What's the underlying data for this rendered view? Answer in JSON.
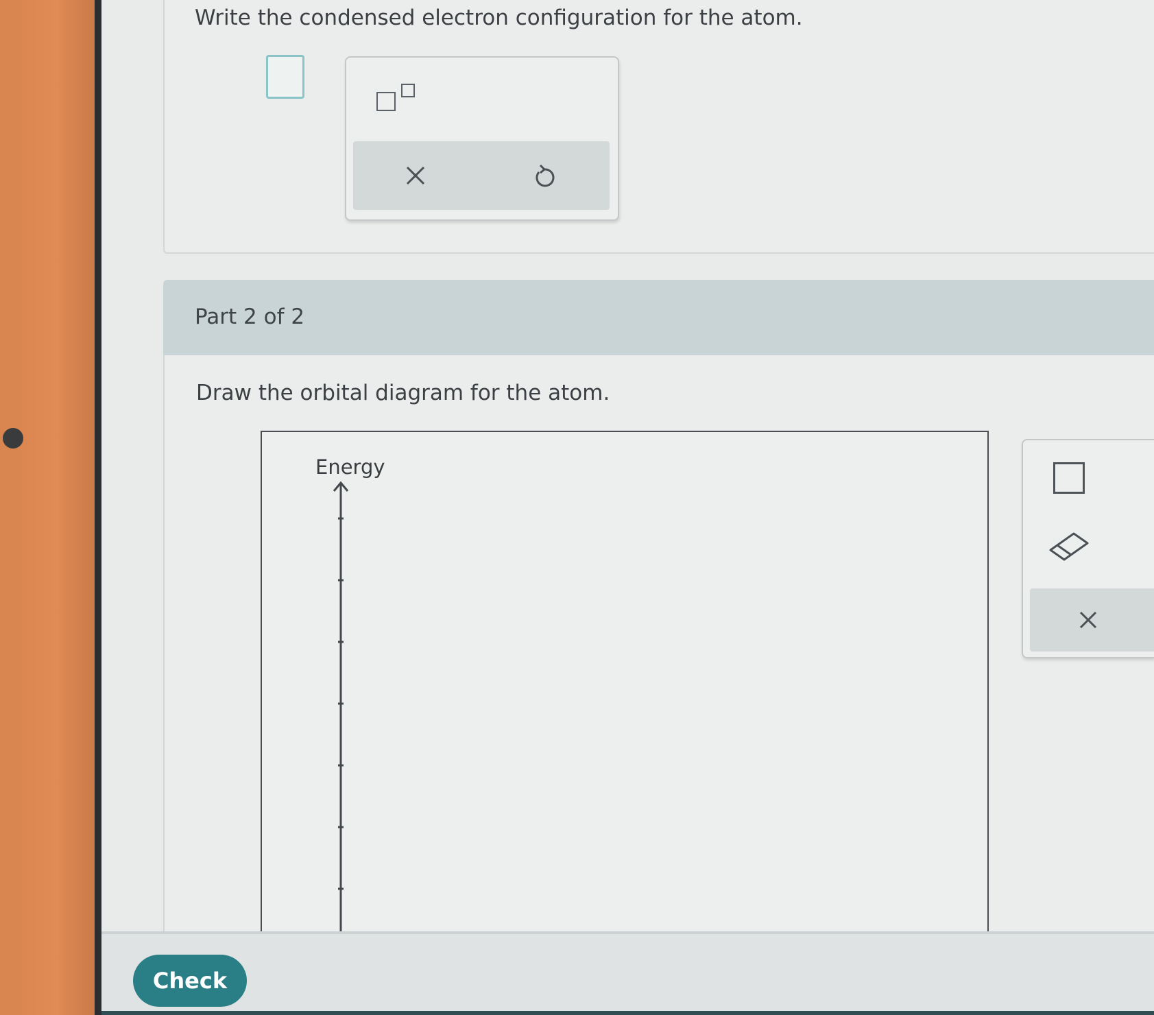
{
  "part1": {
    "prompt": "Write the condensed electron configuration for the atom.",
    "tools": {
      "superscript": "superscript-template-icon",
      "clear": "close-icon",
      "undo": "undo-icon"
    }
  },
  "part2": {
    "header": "Part 2 of 2",
    "prompt": "Draw the orbital diagram for the atom.",
    "diagram": {
      "axis_label": "Energy"
    },
    "tools": {
      "orbital_box": "orbital-box-icon",
      "eraser": "eraser-icon",
      "clear": "close-icon"
    }
  },
  "actions": {
    "check_label": "Check"
  },
  "colors": {
    "accent": "#2a7f86",
    "header_band": "#c9d4d6",
    "answer_box_border": "#8ac4c6",
    "top_accent": "#3f9a6e"
  }
}
